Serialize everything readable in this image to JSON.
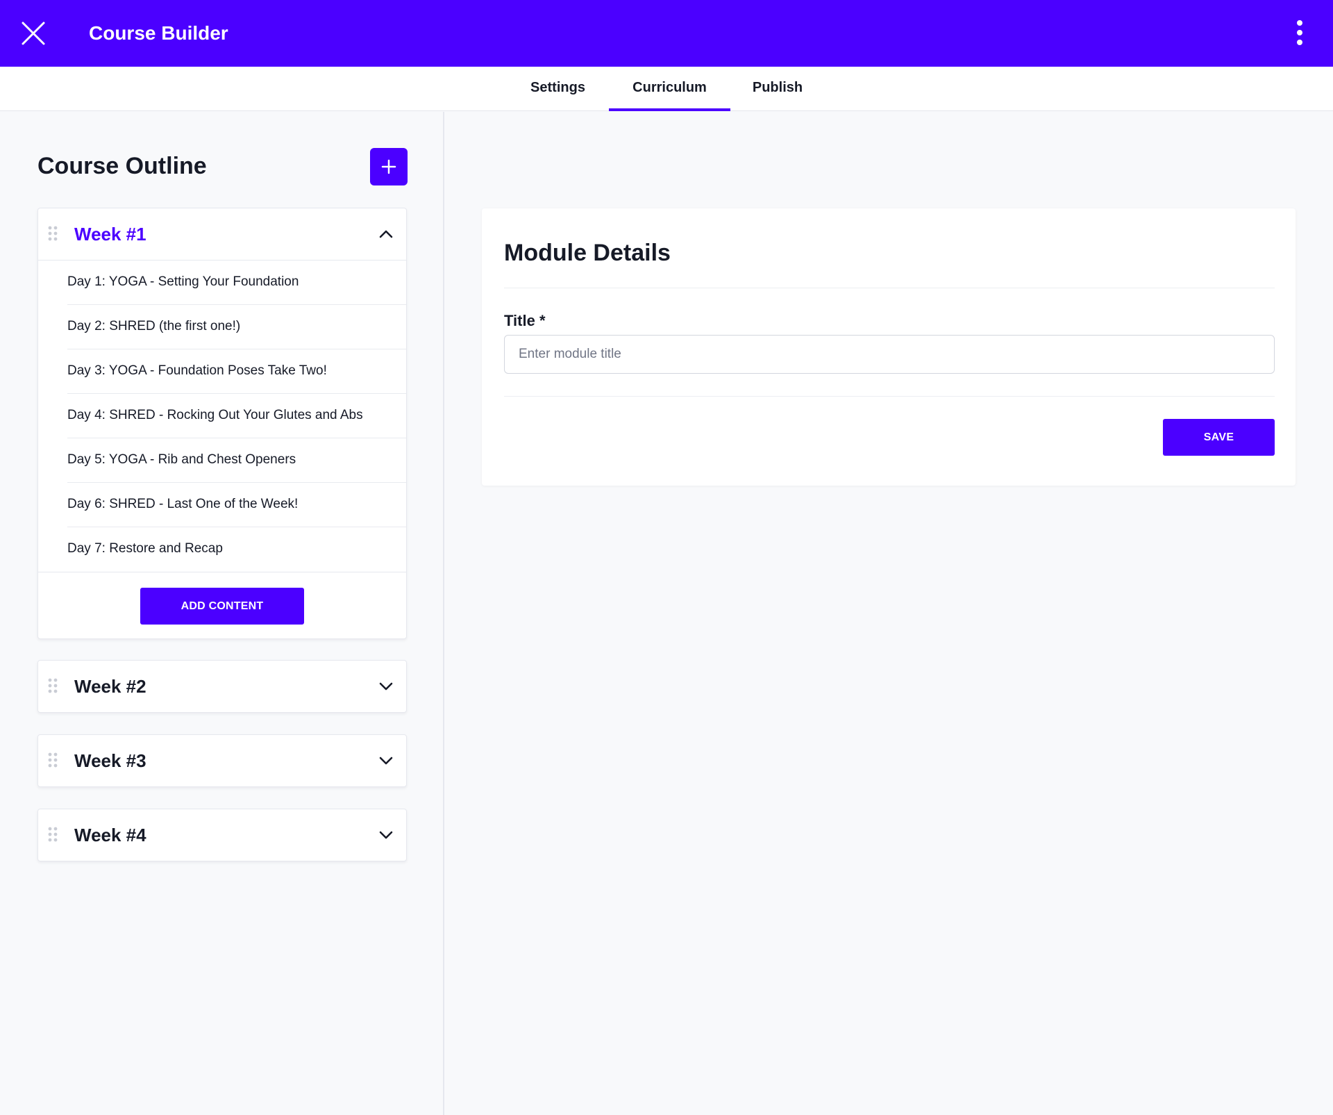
{
  "header": {
    "title": "Course Builder",
    "close_icon": "close-icon",
    "menu_icon": "kebab-menu-icon",
    "background_color": "#4b00ff"
  },
  "tabs": [
    {
      "label": "Settings",
      "active": false
    },
    {
      "label": "Curriculum",
      "active": true
    },
    {
      "label": "Publish",
      "active": false
    }
  ],
  "outline": {
    "title": "Course Outline",
    "add_icon": "plus-icon",
    "weeks": [
      {
        "title": "Week #1",
        "expanded": true,
        "lessons": [
          "Day 1: YOGA - Setting Your Foundation",
          "Day 2: SHRED (the first one!)",
          "Day 3: YOGA - Foundation Poses Take Two!",
          "Day 4: SHRED - Rocking Out Your Glutes and Abs",
          "Day 5: YOGA - Rib and Chest Openers",
          "Day 6: SHRED - Last One of the Week!",
          "Day 7: Restore and Recap"
        ],
        "add_content_label": "ADD CONTENT"
      },
      {
        "title": "Week #2",
        "expanded": false
      },
      {
        "title": "Week #3",
        "expanded": false
      },
      {
        "title": "Week #4",
        "expanded": false
      }
    ]
  },
  "module": {
    "title": "Module Details",
    "field_label": "Title *",
    "input_value": "",
    "input_placeholder": "Enter module title",
    "save_label": "SAVE"
  },
  "colors": {
    "accent": "#4b00ff",
    "text": "#161a27",
    "panel_bg": "#f8f9fb"
  }
}
